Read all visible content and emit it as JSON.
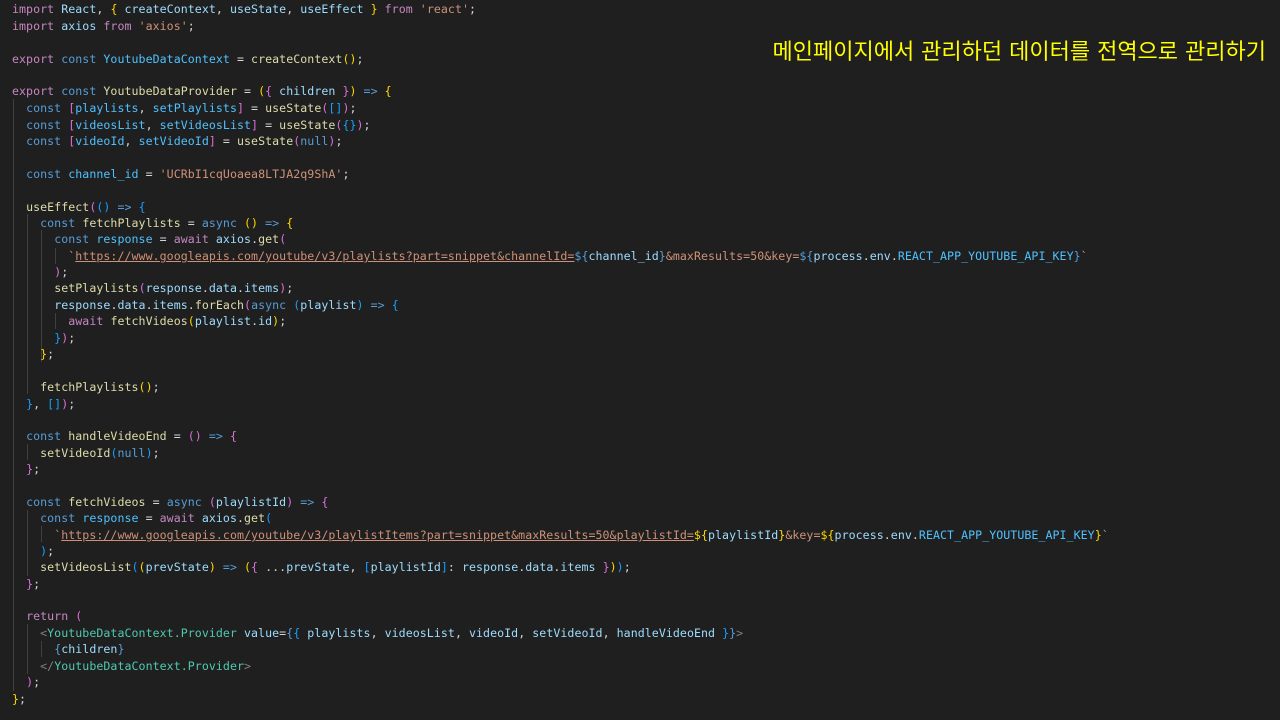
{
  "annotation": "메인페이지에서 관리하던 데이터를 전역으로 관리하기",
  "code": {
    "react_module": "'react'",
    "axios_module": "'axios'",
    "channel_id_value": "'UCRbI1cqUoaea8LTJA2q9ShA'",
    "playlists_url_part1": "https://www.googleapis.com/youtube/v3/playlists?part=snippet&channelId=",
    "playlists_url_part2": "&maxResults=50&key=",
    "playlist_items_url_part1": "https://www.googleapis.com/youtube/v3/playlistItems?part=snippet&maxResults=50&playlistId=",
    "playlist_items_url_part2": "&key=",
    "env_key": "REACT_APP_YOUTUBE_API_KEY"
  },
  "colors": {
    "background": "#1f1f1f",
    "annotation_text": "#ffff00"
  }
}
